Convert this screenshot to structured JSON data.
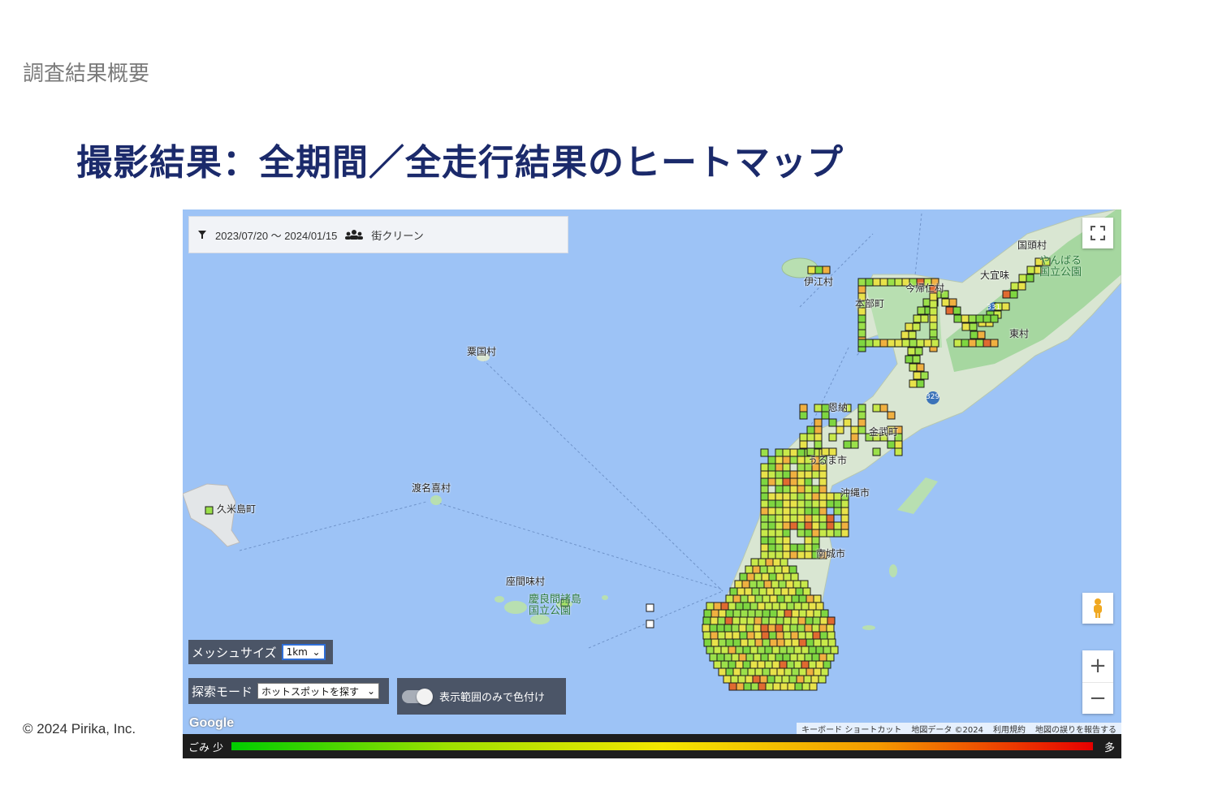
{
  "slide": {
    "section": "調査結果概要",
    "title": "撮影結果：全期間／全走行結果のヒートマップ",
    "copyright": "© 2024 Pirika,  Inc."
  },
  "filter": {
    "date_range": "2023/07/20 〜 2024/01/15",
    "group": "街クリーン",
    "icons": [
      "filter-icon",
      "group-icon"
    ]
  },
  "controls": {
    "mesh_label": "メッシュサイズ",
    "mesh_value": "1km",
    "mode_label": "探索モード",
    "mode_value": "ホットスポットを探す",
    "toggle_label": "表示範囲のみで色付け"
  },
  "places": {
    "kunigami": "国頭村",
    "ogimi": "大宜味",
    "yanbaru": "やんばる",
    "yanbaru2": "国立公園",
    "nakijin": "今帰仁村",
    "motobu": "本部町",
    "higashi": "東村",
    "iejima": "伊江村",
    "onna": "恩納",
    "kin": "金武町",
    "aguni": "粟国村",
    "tonaki": "渡名喜村",
    "kumejima": "久米島町",
    "zamami": "座間味村",
    "kerama1": "慶良間諸島",
    "kerama2": "国立公園",
    "okinawa_label": "沖縄市",
    "nanjo": "南城市",
    "uruma": "うるま市",
    "route331": "331",
    "route329": "329"
  },
  "attribution": {
    "shortcut": "キーボード ショートカット",
    "mapdata": "地図データ ©2024",
    "terms": "利用規約",
    "report": "地図の誤りを報告する"
  },
  "legend": {
    "low": "ごみ  少",
    "high": "多"
  },
  "brand": "Google",
  "colors": {
    "sea": "#9dc3f6",
    "land": "#d9e6d2",
    "forest": "#a6d7a0",
    "title": "#1b2a6b",
    "control_bg": "#4b5567"
  }
}
